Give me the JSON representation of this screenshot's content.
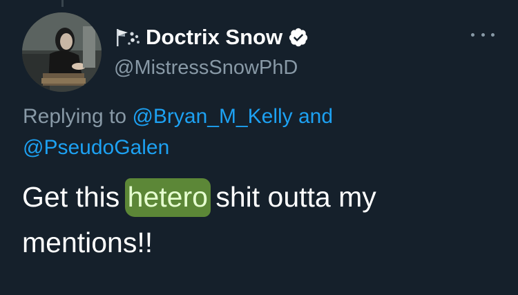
{
  "tweet": {
    "name_emoji": "flag-and-sparkles",
    "display_name": "Doctrix Snow",
    "verified": true,
    "handle": "@MistressSnowPhD",
    "reply": {
      "prefix": "Replying to ",
      "mention_1": "@Bryan_M_Kelly",
      "connector": " and",
      "mention_2": "@PseudoGalen"
    },
    "text": {
      "before": "Get this ",
      "highlighted": "hetero",
      "after": " shit outta my mentions!!"
    },
    "more_icon": "more-horizontal-icon"
  },
  "colors": {
    "background": "#15202b",
    "primary_text": "#ffffff",
    "secondary_text": "#8899a6",
    "link": "#1da1f2",
    "highlight": "#78af3c"
  }
}
